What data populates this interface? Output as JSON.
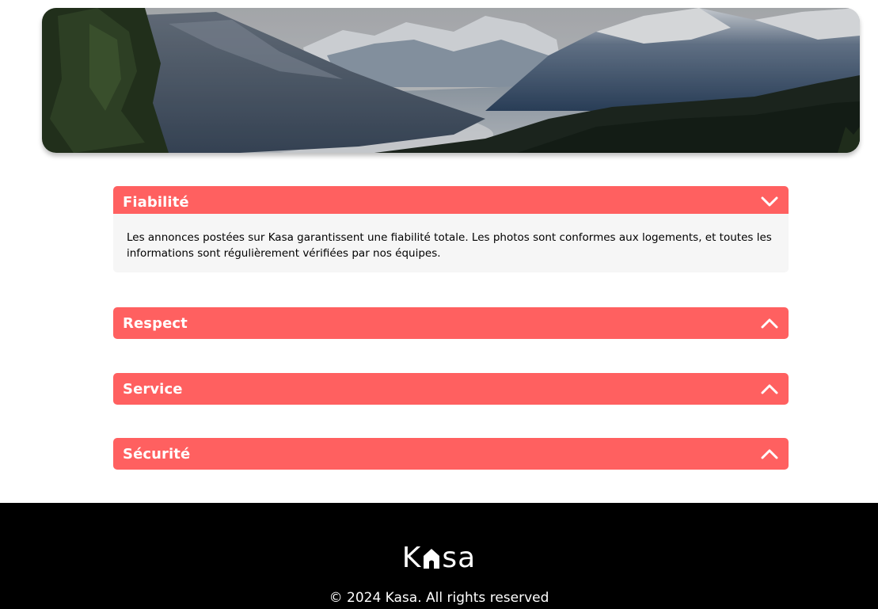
{
  "banner": {
    "image": "mountain-landscape"
  },
  "collapses": [
    {
      "title": "Fiabilité",
      "expanded": true,
      "icon": "chevron-down-icon",
      "body": "Les annonces postées sur Kasa garantissent une fiabilité totale. Les photos sont conformes aux logements, et toutes les informations sont régulièrement vérifiées par nos équipes."
    },
    {
      "title": "Respect",
      "expanded": false,
      "icon": "chevron-up-icon"
    },
    {
      "title": "Service",
      "expanded": false,
      "icon": "chevron-up-icon"
    },
    {
      "title": "Sécurité",
      "expanded": false,
      "icon": "chevron-up-icon"
    }
  ],
  "footer": {
    "logo_left": "K",
    "logo_right": "sa",
    "copyright": "© 2024 Kasa. All rights reserved"
  },
  "colors": {
    "accent": "#FF6060",
    "panel_bg": "#F6F6F6",
    "footer_bg": "#000000"
  }
}
